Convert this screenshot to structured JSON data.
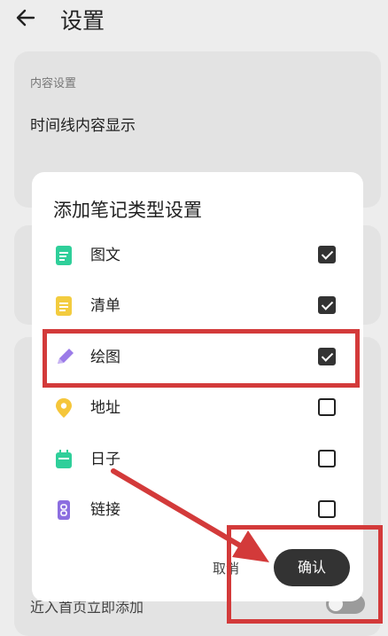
{
  "header": {
    "title": "设置"
  },
  "settings": {
    "section_label": "内容设置",
    "first_item": "时间线内容显示",
    "bottom_item": "近入首页立即添加"
  },
  "dialog": {
    "title": "添加笔记类型设置",
    "items": [
      {
        "label": "图文",
        "icon": "image-text-icon",
        "icon_color": "#2fcf9a",
        "checked": true
      },
      {
        "label": "清单",
        "icon": "checklist-icon",
        "icon_color": "#f3cc3f",
        "checked": true
      },
      {
        "label": "绘图",
        "icon": "pen-icon",
        "icon_color": "#9b7be8",
        "checked": true
      },
      {
        "label": "地址",
        "icon": "location-pin-icon",
        "icon_color": "#f5c63a",
        "checked": false
      },
      {
        "label": "日子",
        "icon": "calendar-icon",
        "icon_color": "#2fcf9a",
        "checked": false
      },
      {
        "label": "链接",
        "icon": "link-icon",
        "icon_color": "#8c6ee0",
        "checked": false
      }
    ],
    "cancel_label": "取消",
    "confirm_label": "确认"
  },
  "colors": {
    "annotation": "#d33a3a",
    "confirm_bg": "#333333"
  }
}
